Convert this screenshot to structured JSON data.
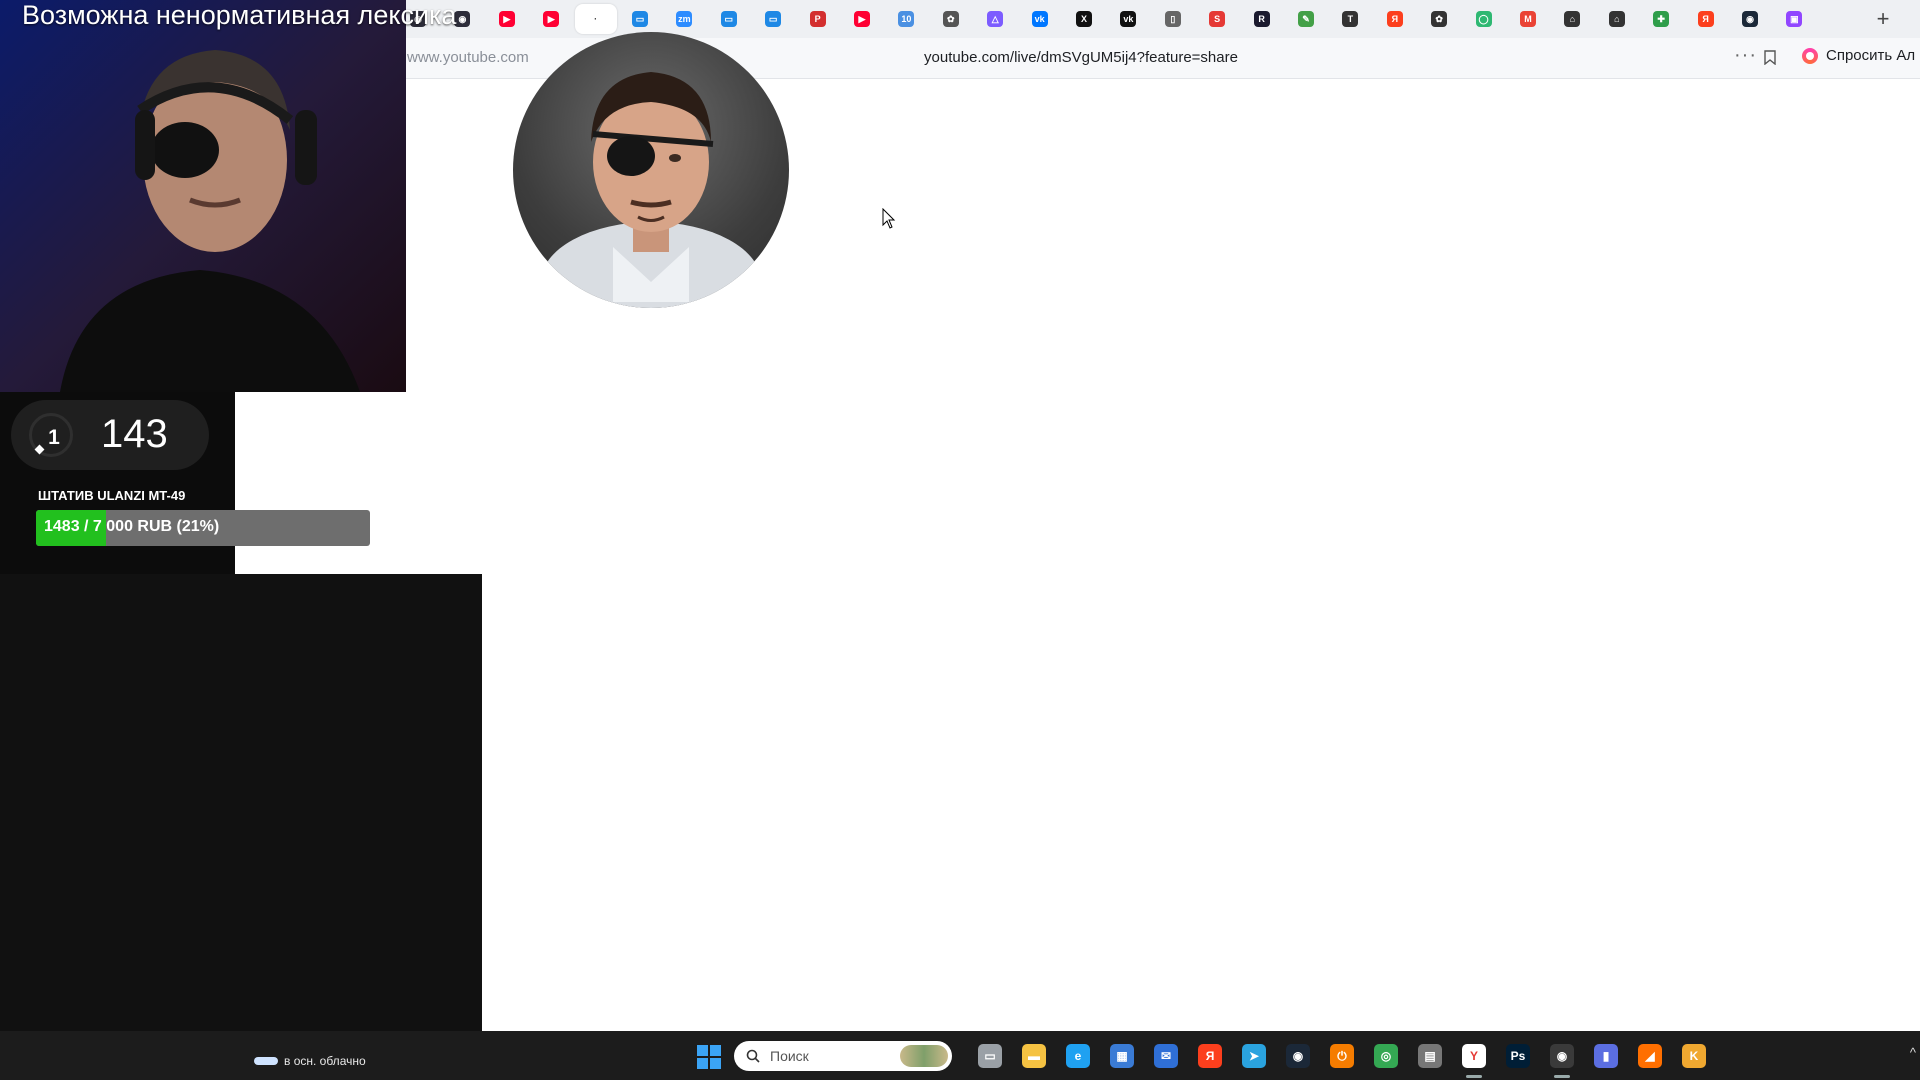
{
  "browser": {
    "tabs": [
      {
        "icon": "obs-icon",
        "color": "#2d2d3a",
        "glyph": "◉"
      },
      {
        "icon": "obs-icon",
        "color": "#2d2d3a",
        "glyph": "◉"
      },
      {
        "icon": "youtube-icon",
        "color": "#ff0033",
        "glyph": "▶"
      },
      {
        "icon": "youtube-icon",
        "color": "#ff0033",
        "glyph": "▶"
      },
      {
        "icon": "blank-tab-icon",
        "color": "#ffffff",
        "glyph": "·",
        "active": true
      },
      {
        "icon": "chat-icon",
        "color": "#1e88e5",
        "glyph": "▭"
      },
      {
        "icon": "zoom-icon",
        "color": "#2d8cff",
        "glyph": "zm"
      },
      {
        "icon": "chat-icon",
        "color": "#1e88e5",
        "glyph": "▭"
      },
      {
        "icon": "chat-icon",
        "color": "#1e88e5",
        "glyph": "▭"
      },
      {
        "icon": "pdf-icon",
        "color": "#d32f2f",
        "glyph": "P"
      },
      {
        "icon": "youtube-icon",
        "color": "#ff0033",
        "glyph": "▶"
      },
      {
        "icon": "calendar-icon",
        "color": "#4a90e2",
        "glyph": "10"
      },
      {
        "icon": "openai-icon",
        "color": "#555555",
        "glyph": "✿"
      },
      {
        "icon": "triangle-icon",
        "color": "#7c5cff",
        "glyph": "△"
      },
      {
        "icon": "vk-icon",
        "color": "#0077ff",
        "glyph": "vk"
      },
      {
        "icon": "x-icon",
        "color": "#111111",
        "glyph": "X"
      },
      {
        "icon": "vk-icon",
        "color": "#111111",
        "glyph": "vk"
      },
      {
        "icon": "document-icon",
        "color": "#666666",
        "glyph": "▯"
      },
      {
        "icon": "s-icon",
        "color": "#e53935",
        "glyph": "S"
      },
      {
        "icon": "r-icon",
        "color": "#1a1a2e",
        "glyph": "R"
      },
      {
        "icon": "puzzle-icon",
        "color": "#43a047",
        "glyph": "✎"
      },
      {
        "icon": "t-icon",
        "color": "#333333",
        "glyph": "T"
      },
      {
        "icon": "yandex-icon",
        "color": "#fc3f1d",
        "glyph": "Я"
      },
      {
        "icon": "openai-icon",
        "color": "#333333",
        "glyph": "✿"
      },
      {
        "icon": "circle-icon",
        "color": "#2eb872",
        "glyph": "◯"
      },
      {
        "icon": "gmail-icon",
        "color": "#ea4335",
        "glyph": "M"
      },
      {
        "icon": "house-icon",
        "color": "#333333",
        "glyph": "⌂"
      },
      {
        "icon": "house-icon",
        "color": "#333333",
        "glyph": "⌂"
      },
      {
        "icon": "puzzle-icon",
        "color": "#2e9d4a",
        "glyph": "✚"
      },
      {
        "icon": "yandex-icon",
        "color": "#fc3f1d",
        "glyph": "Я"
      },
      {
        "icon": "steam-icon",
        "color": "#1b2838",
        "glyph": "◉"
      },
      {
        "icon": "twitch-icon",
        "color": "#9146ff",
        "glyph": "▣"
      }
    ],
    "new_tab_label": "+",
    "domain_hint": "www.youtube.com",
    "url": "youtube.com/live/dmSVgUM5ij4?feature=share",
    "more_label": "···",
    "ask_alice_label": "Спросить Ал"
  },
  "stream_overlay": {
    "warning_text": "Возможна ненормативная лексика",
    "counter_small": "1",
    "counter_big": "143",
    "goal_title": "ШТАТИВ ULANZI MT-49",
    "goal_text": "1483 / 7 000 RUB (21%)",
    "goal_progress": 0.21,
    "goal_color": "#22c01e"
  },
  "taskbar": {
    "weather_text": "в осн. облачно",
    "search_placeholder": "Поиск",
    "apps": [
      {
        "icon": "task-view-icon",
        "color": "#9aa0a6",
        "glyph": "▭"
      },
      {
        "icon": "file-explorer-icon",
        "color": "#f5c242",
        "glyph": "▬"
      },
      {
        "icon": "edge-icon",
        "color": "#1fa1f1",
        "glyph": "e"
      },
      {
        "icon": "store-icon",
        "color": "#3a7bd5",
        "glyph": "▦"
      },
      {
        "icon": "mail-icon",
        "color": "#2f6fd6",
        "glyph": "✉"
      },
      {
        "icon": "yandex-icon",
        "color": "#fc3f1d",
        "glyph": "Я"
      },
      {
        "icon": "telegram-icon",
        "color": "#2aa3df",
        "glyph": "➤"
      },
      {
        "icon": "steam-icon",
        "color": "#1b2838",
        "glyph": "◉"
      },
      {
        "icon": "power-icon",
        "color": "#f57c00",
        "glyph": "⏻"
      },
      {
        "icon": "chrome-icon",
        "color": "#34a853",
        "glyph": "◎"
      },
      {
        "icon": "printer-icon",
        "color": "#777777",
        "glyph": "▤"
      },
      {
        "icon": "yandex-browser-icon",
        "color": "#ffffff",
        "glyph": "Y",
        "active": true
      },
      {
        "icon": "photoshop-icon",
        "color": "#001e36",
        "glyph": "Ps"
      },
      {
        "icon": "obs-icon",
        "color": "#3a3a3a",
        "glyph": "◉",
        "active": true
      },
      {
        "icon": "stats-icon",
        "color": "#5b6ee1",
        "glyph": "▮"
      },
      {
        "icon": "sublime-icon",
        "color": "#ff6f00",
        "glyph": "◢"
      },
      {
        "icon": "kotlin-icon",
        "color": "#f0a830",
        "glyph": "K"
      }
    ]
  }
}
